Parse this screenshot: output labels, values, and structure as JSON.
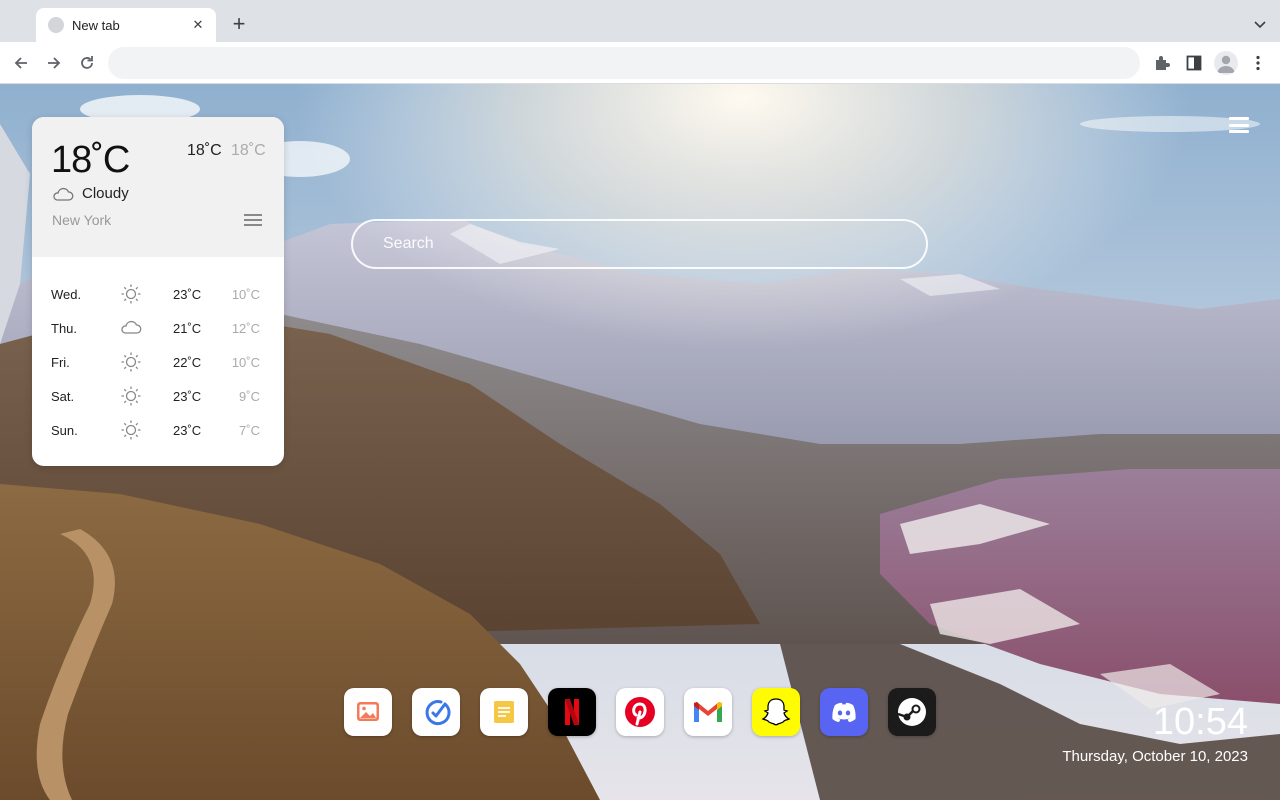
{
  "browser": {
    "tab": {
      "title": "New tab"
    },
    "omnibox": {
      "value": ""
    }
  },
  "search": {
    "placeholder": "Search"
  },
  "weather": {
    "current_temp": "18˚C",
    "high": "18˚C",
    "low": "18˚C",
    "condition": "Cloudy",
    "condition_icon": "cloud-icon",
    "city": "New York",
    "forecast": [
      {
        "day": "Wed.",
        "icon": "sun-icon",
        "high": "23˚C",
        "low": "10˚C"
      },
      {
        "day": "Thu.",
        "icon": "cloud-icon",
        "high": "21˚C",
        "low": "12˚C"
      },
      {
        "day": "Fri.",
        "icon": "sun-icon",
        "high": "22˚C",
        "low": "10˚C"
      },
      {
        "day": "Sat.",
        "icon": "sun-icon",
        "high": "23˚C",
        "low": "9˚C"
      },
      {
        "day": "Sun.",
        "icon": "sun-icon",
        "high": "23˚C",
        "low": "7˚C"
      }
    ]
  },
  "dock": {
    "apps": [
      {
        "name": "photos",
        "icon": "photos-icon",
        "color": "#ffffff"
      },
      {
        "name": "tasks",
        "icon": "tasks-icon",
        "color": "#ffffff"
      },
      {
        "name": "notes",
        "icon": "notes-icon",
        "color": "#ffffff"
      },
      {
        "name": "netflix",
        "icon": "netflix-icon",
        "color": "#000000"
      },
      {
        "name": "pinterest",
        "icon": "pinterest-icon",
        "color": "#ffffff"
      },
      {
        "name": "gmail",
        "icon": "gmail-icon",
        "color": "#ffffff"
      },
      {
        "name": "snapchat",
        "icon": "snapchat-icon",
        "color": "#fffc00"
      },
      {
        "name": "discord",
        "icon": "discord-icon",
        "color": "#5865f2"
      },
      {
        "name": "steam",
        "icon": "steam-icon",
        "color": "#1b1b1b"
      }
    ]
  },
  "clock": {
    "time": "10:54",
    "date": "Thursday, October 10, 2023"
  }
}
